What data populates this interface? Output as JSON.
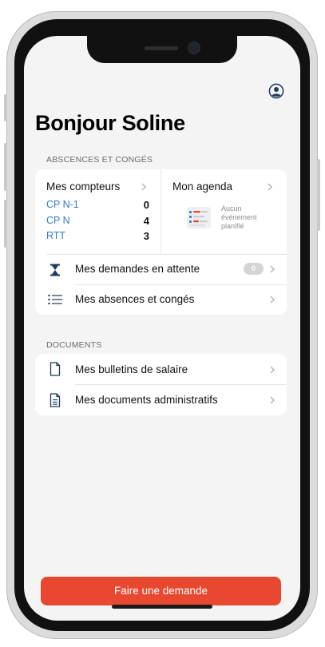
{
  "greeting": "Bonjour Soline",
  "absences": {
    "section_label": "ABSCENCES ET CONGÉS",
    "counters": {
      "title": "Mes compteurs",
      "items": [
        {
          "label": "CP N-1",
          "value": "0"
        },
        {
          "label": "CP N",
          "value": "4"
        },
        {
          "label": "RTT",
          "value": "3"
        }
      ]
    },
    "agenda": {
      "title": "Mon agenda",
      "empty_lines": [
        "Aucun",
        "événement",
        "planifié"
      ]
    },
    "pending": {
      "label": "Mes demandes en attente",
      "count": "0"
    },
    "list": {
      "label": "Mes absences et congés"
    }
  },
  "documents": {
    "section_label": "DOCUMENTS",
    "payslips": {
      "label": "Mes bulletins de salaire"
    },
    "admin": {
      "label": "Mes documents administratifs"
    }
  },
  "cta": {
    "label": "Faire une demande"
  },
  "colors": {
    "accent": "#e8482f",
    "link": "#2f7fc7",
    "icon": "#1e3a5f"
  },
  "icons": [
    "profile-icon",
    "chevron-right-icon",
    "hourglass-icon",
    "list-icon",
    "document-icon",
    "document-lines-icon",
    "calendar-illustration"
  ]
}
